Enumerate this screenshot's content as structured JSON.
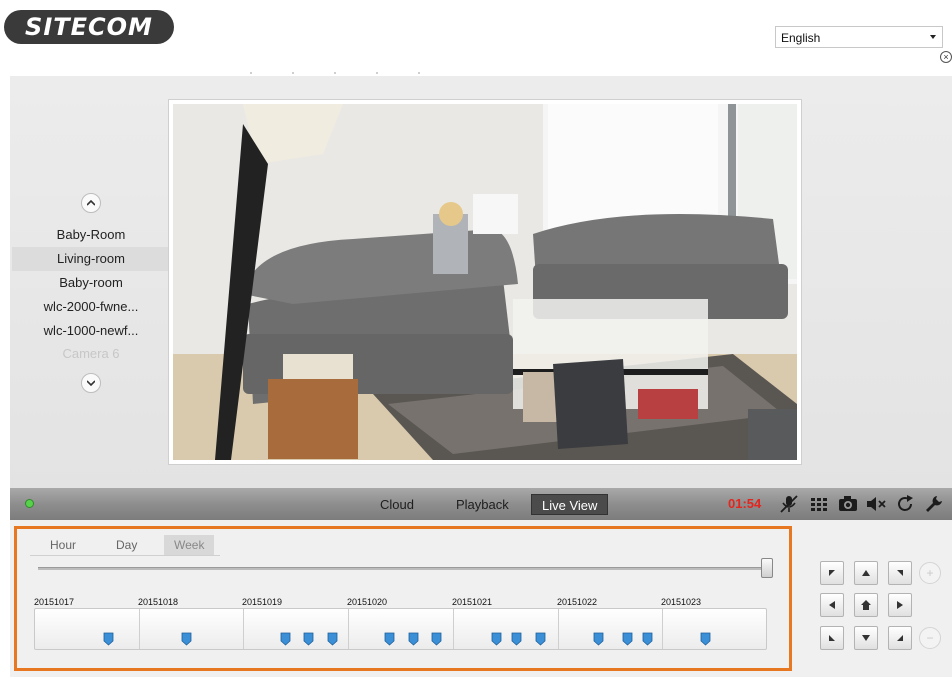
{
  "header": {
    "logo_text": "SITECOM",
    "language": "English"
  },
  "cameras": {
    "items": [
      {
        "label": "Baby-Room",
        "selected": false,
        "disabled": false
      },
      {
        "label": "Living-room",
        "selected": true,
        "disabled": false
      },
      {
        "label": "Baby-room",
        "selected": false,
        "disabled": false
      },
      {
        "label": "wlc-2000-fwne...",
        "selected": false,
        "disabled": false
      },
      {
        "label": "wlc-1000-newf...",
        "selected": false,
        "disabled": false
      },
      {
        "label": "Camera 6",
        "selected": false,
        "disabled": true
      }
    ]
  },
  "toolbar": {
    "cloud_label": "Cloud",
    "playback_label": "Playback",
    "liveview_label": "Live View",
    "time": "01:54"
  },
  "timeline": {
    "tabs": [
      "Hour",
      "Day",
      "Week"
    ],
    "active_tab": "Week",
    "dates": [
      "20151017",
      "20151018",
      "20151019",
      "20151020",
      "20151021",
      "20151022",
      "20151023"
    ]
  },
  "colors": {
    "accent_orange": "#e87722",
    "marker_blue": "#3a8fd6",
    "time_red": "#e3261f"
  }
}
